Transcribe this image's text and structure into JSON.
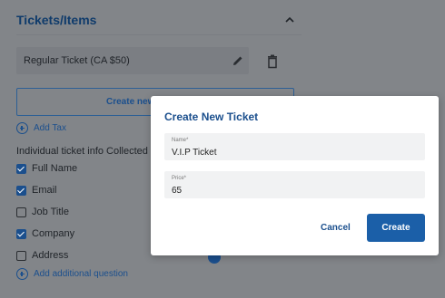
{
  "section": {
    "title": "Tickets/Items",
    "ticket_label": "Regular Ticket (CA $50)",
    "create_button_label": "Create new",
    "add_tax_label": "Add Tax",
    "info_label": "Individual ticket info Collected (e",
    "fields": [
      {
        "label": "Full Name",
        "checked": true
      },
      {
        "label": "Email",
        "checked": true
      },
      {
        "label": "Job Title",
        "checked": false
      },
      {
        "label": "Company",
        "checked": true
      },
      {
        "label": "Address",
        "checked": false
      }
    ],
    "add_question_label": "Add additional question"
  },
  "modal": {
    "title": "Create New Ticket",
    "name_label": "Name*",
    "name_value": "V.I.P Ticket",
    "price_label": "Price*",
    "price_value": "65",
    "cancel_label": "Cancel",
    "create_label": "Create"
  },
  "colors": {
    "accent": "#1b5fa8",
    "overlay": "#828589"
  }
}
